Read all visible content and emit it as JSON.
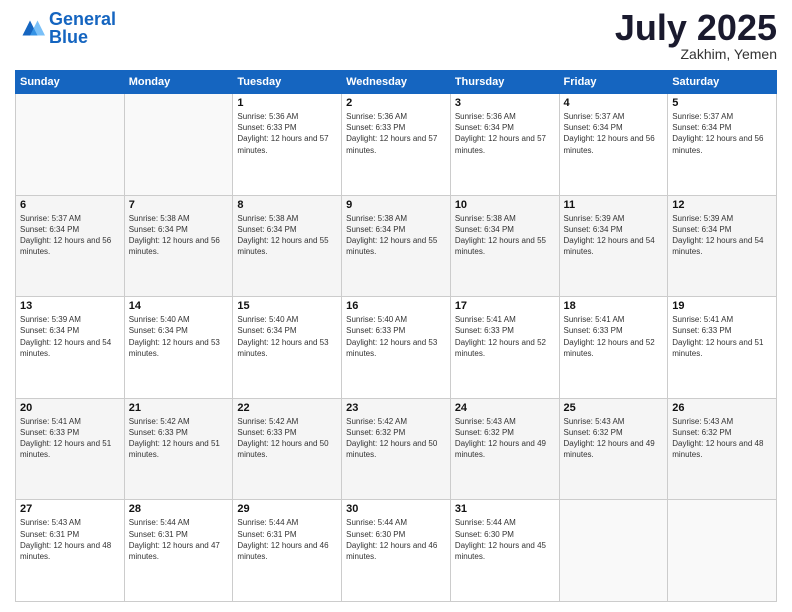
{
  "header": {
    "logo_general": "General",
    "logo_blue": "Blue",
    "month_year": "July 2025",
    "location": "Zakhim, Yemen"
  },
  "days_of_week": [
    "Sunday",
    "Monday",
    "Tuesday",
    "Wednesday",
    "Thursday",
    "Friday",
    "Saturday"
  ],
  "weeks": [
    [
      {
        "day": "",
        "sunrise": "",
        "sunset": "",
        "daylight": ""
      },
      {
        "day": "",
        "sunrise": "",
        "sunset": "",
        "daylight": ""
      },
      {
        "day": "1",
        "sunrise": "Sunrise: 5:36 AM",
        "sunset": "Sunset: 6:33 PM",
        "daylight": "Daylight: 12 hours and 57 minutes."
      },
      {
        "day": "2",
        "sunrise": "Sunrise: 5:36 AM",
        "sunset": "Sunset: 6:33 PM",
        "daylight": "Daylight: 12 hours and 57 minutes."
      },
      {
        "day": "3",
        "sunrise": "Sunrise: 5:36 AM",
        "sunset": "Sunset: 6:34 PM",
        "daylight": "Daylight: 12 hours and 57 minutes."
      },
      {
        "day": "4",
        "sunrise": "Sunrise: 5:37 AM",
        "sunset": "Sunset: 6:34 PM",
        "daylight": "Daylight: 12 hours and 56 minutes."
      },
      {
        "day": "5",
        "sunrise": "Sunrise: 5:37 AM",
        "sunset": "Sunset: 6:34 PM",
        "daylight": "Daylight: 12 hours and 56 minutes."
      }
    ],
    [
      {
        "day": "6",
        "sunrise": "Sunrise: 5:37 AM",
        "sunset": "Sunset: 6:34 PM",
        "daylight": "Daylight: 12 hours and 56 minutes."
      },
      {
        "day": "7",
        "sunrise": "Sunrise: 5:38 AM",
        "sunset": "Sunset: 6:34 PM",
        "daylight": "Daylight: 12 hours and 56 minutes."
      },
      {
        "day": "8",
        "sunrise": "Sunrise: 5:38 AM",
        "sunset": "Sunset: 6:34 PM",
        "daylight": "Daylight: 12 hours and 55 minutes."
      },
      {
        "day": "9",
        "sunrise": "Sunrise: 5:38 AM",
        "sunset": "Sunset: 6:34 PM",
        "daylight": "Daylight: 12 hours and 55 minutes."
      },
      {
        "day": "10",
        "sunrise": "Sunrise: 5:38 AM",
        "sunset": "Sunset: 6:34 PM",
        "daylight": "Daylight: 12 hours and 55 minutes."
      },
      {
        "day": "11",
        "sunrise": "Sunrise: 5:39 AM",
        "sunset": "Sunset: 6:34 PM",
        "daylight": "Daylight: 12 hours and 54 minutes."
      },
      {
        "day": "12",
        "sunrise": "Sunrise: 5:39 AM",
        "sunset": "Sunset: 6:34 PM",
        "daylight": "Daylight: 12 hours and 54 minutes."
      }
    ],
    [
      {
        "day": "13",
        "sunrise": "Sunrise: 5:39 AM",
        "sunset": "Sunset: 6:34 PM",
        "daylight": "Daylight: 12 hours and 54 minutes."
      },
      {
        "day": "14",
        "sunrise": "Sunrise: 5:40 AM",
        "sunset": "Sunset: 6:34 PM",
        "daylight": "Daylight: 12 hours and 53 minutes."
      },
      {
        "day": "15",
        "sunrise": "Sunrise: 5:40 AM",
        "sunset": "Sunset: 6:34 PM",
        "daylight": "Daylight: 12 hours and 53 minutes."
      },
      {
        "day": "16",
        "sunrise": "Sunrise: 5:40 AM",
        "sunset": "Sunset: 6:33 PM",
        "daylight": "Daylight: 12 hours and 53 minutes."
      },
      {
        "day": "17",
        "sunrise": "Sunrise: 5:41 AM",
        "sunset": "Sunset: 6:33 PM",
        "daylight": "Daylight: 12 hours and 52 minutes."
      },
      {
        "day": "18",
        "sunrise": "Sunrise: 5:41 AM",
        "sunset": "Sunset: 6:33 PM",
        "daylight": "Daylight: 12 hours and 52 minutes."
      },
      {
        "day": "19",
        "sunrise": "Sunrise: 5:41 AM",
        "sunset": "Sunset: 6:33 PM",
        "daylight": "Daylight: 12 hours and 51 minutes."
      }
    ],
    [
      {
        "day": "20",
        "sunrise": "Sunrise: 5:41 AM",
        "sunset": "Sunset: 6:33 PM",
        "daylight": "Daylight: 12 hours and 51 minutes."
      },
      {
        "day": "21",
        "sunrise": "Sunrise: 5:42 AM",
        "sunset": "Sunset: 6:33 PM",
        "daylight": "Daylight: 12 hours and 51 minutes."
      },
      {
        "day": "22",
        "sunrise": "Sunrise: 5:42 AM",
        "sunset": "Sunset: 6:33 PM",
        "daylight": "Daylight: 12 hours and 50 minutes."
      },
      {
        "day": "23",
        "sunrise": "Sunrise: 5:42 AM",
        "sunset": "Sunset: 6:32 PM",
        "daylight": "Daylight: 12 hours and 50 minutes."
      },
      {
        "day": "24",
        "sunrise": "Sunrise: 5:43 AM",
        "sunset": "Sunset: 6:32 PM",
        "daylight": "Daylight: 12 hours and 49 minutes."
      },
      {
        "day": "25",
        "sunrise": "Sunrise: 5:43 AM",
        "sunset": "Sunset: 6:32 PM",
        "daylight": "Daylight: 12 hours and 49 minutes."
      },
      {
        "day": "26",
        "sunrise": "Sunrise: 5:43 AM",
        "sunset": "Sunset: 6:32 PM",
        "daylight": "Daylight: 12 hours and 48 minutes."
      }
    ],
    [
      {
        "day": "27",
        "sunrise": "Sunrise: 5:43 AM",
        "sunset": "Sunset: 6:31 PM",
        "daylight": "Daylight: 12 hours and 48 minutes."
      },
      {
        "day": "28",
        "sunrise": "Sunrise: 5:44 AM",
        "sunset": "Sunset: 6:31 PM",
        "daylight": "Daylight: 12 hours and 47 minutes."
      },
      {
        "day": "29",
        "sunrise": "Sunrise: 5:44 AM",
        "sunset": "Sunset: 6:31 PM",
        "daylight": "Daylight: 12 hours and 46 minutes."
      },
      {
        "day": "30",
        "sunrise": "Sunrise: 5:44 AM",
        "sunset": "Sunset: 6:30 PM",
        "daylight": "Daylight: 12 hours and 46 minutes."
      },
      {
        "day": "31",
        "sunrise": "Sunrise: 5:44 AM",
        "sunset": "Sunset: 6:30 PM",
        "daylight": "Daylight: 12 hours and 45 minutes."
      },
      {
        "day": "",
        "sunrise": "",
        "sunset": "",
        "daylight": ""
      },
      {
        "day": "",
        "sunrise": "",
        "sunset": "",
        "daylight": ""
      }
    ]
  ]
}
